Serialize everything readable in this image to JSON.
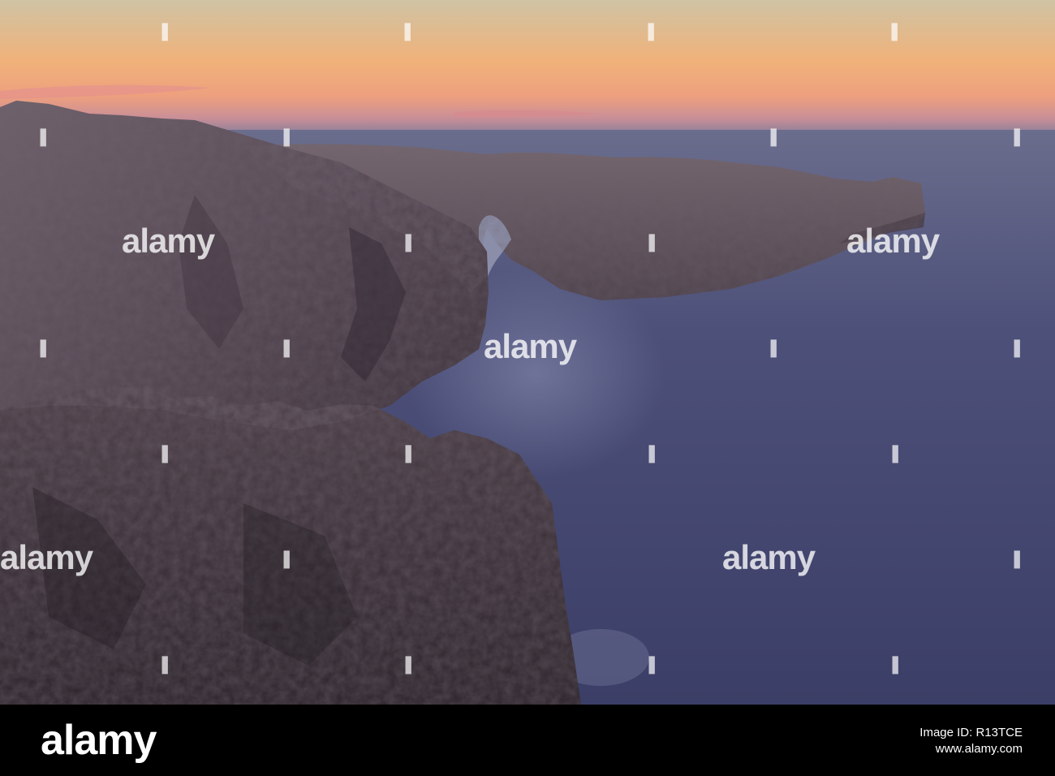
{
  "image": {
    "subject": "sea-arch-at-sunset",
    "colors": {
      "sky_top": "#d8c6a0",
      "sky_glow": "#f2a870",
      "sky_pink": "#e6949a",
      "sea": "#44476e",
      "rock": "#5a4c58",
      "rock_dark": "#2d2630"
    }
  },
  "watermarks": {
    "text": "alamy"
  },
  "footer": {
    "logo": "alamy",
    "image_id_line": "Image ID: R13TCE",
    "site_line": "www.alamy.com"
  }
}
